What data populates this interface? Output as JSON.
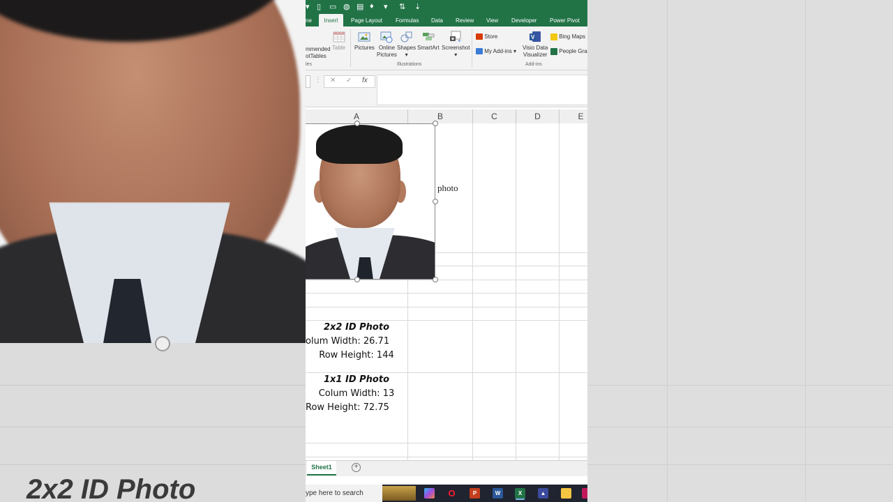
{
  "background_overlay": {
    "zoomed_caption": "2x2 ID Photo"
  },
  "ribbon": {
    "tabs": [
      "ne",
      "Insert",
      "Page Layout",
      "Formulas",
      "Data",
      "Review",
      "View",
      "Developer",
      "Power Pivot"
    ],
    "active_tab": "Insert",
    "tables_group": {
      "btn1_line1": "mmended",
      "btn1_line2": "otTables",
      "btn2": "Table",
      "label": "les"
    },
    "illustrations": {
      "label": "Illustrations",
      "pictures": "Pictures",
      "online_pictures_line1": "Online",
      "online_pictures_line2": "Pictures",
      "shapes": "Shapes",
      "smartart": "SmartArt",
      "screenshot": "Screenshot"
    },
    "addins": {
      "label": "Add-ins",
      "store": "Store",
      "my_addins": "My Add-ins",
      "visio_line1": "Visio Data",
      "visio_line2": "Visualizer",
      "bing_maps": "Bing Maps",
      "people_graph": "People Grap"
    }
  },
  "formula_bar": {
    "fx": "fx",
    "cancel": "✕",
    "enter": "✓"
  },
  "columns": [
    "A",
    "B",
    "C",
    "D",
    "E"
  ],
  "cells": {
    "b1": "photo",
    "a_2x2_title": "2x2 ID Photo",
    "a_2x2_width": "olum Width: 26.71",
    "a_2x2_height": "Row Height: 144",
    "a_1x1_title": "1x1 ID Photo",
    "a_1x1_width": "Colum Width: 13",
    "a_1x1_height": "Row Height: 72.75"
  },
  "sheet": {
    "name": "Sheet1",
    "add": "+"
  },
  "taskbar": {
    "search": "ype here to search",
    "apps": [
      "copilot-icon",
      "opera-icon",
      "powerpoint-icon",
      "word-icon",
      "excel-icon",
      "media-icon",
      "file-explorer-icon",
      "app-icon"
    ]
  },
  "colors": {
    "excel_green": "#217346",
    "ribbon_bg": "#f3f3f3",
    "grid": "#d9d9d9"
  }
}
